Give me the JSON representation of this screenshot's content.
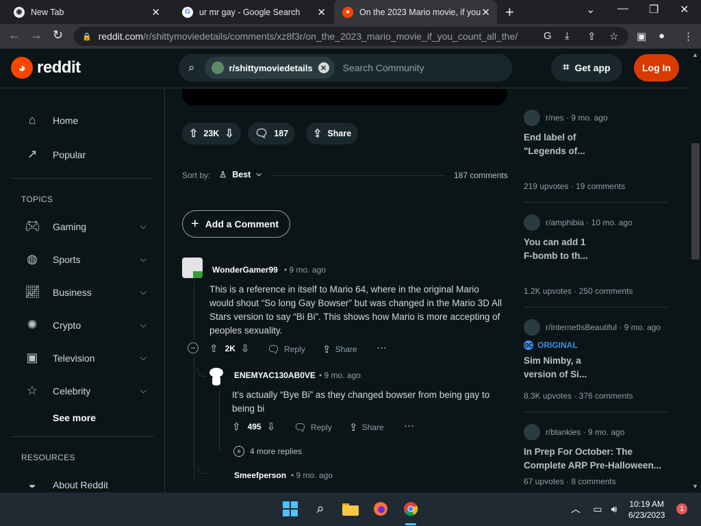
{
  "browser": {
    "tabs": [
      {
        "title": "New Tab"
      },
      {
        "title": "ur mr gay - Google Search"
      },
      {
        "title": "On the 2023 Mario movie, if you"
      }
    ],
    "url_host": "reddit.com",
    "url_path": "/r/shittymoviedetails/comments/xz8f3r/on_the_2023_mario_movie_if_you_count_all_the/"
  },
  "header": {
    "logo_text": "reddit",
    "community_chip": "r/shittymoviedetails",
    "search_placeholder": "Search Community",
    "get_app": "Get app",
    "login": "Log In"
  },
  "sidebar": {
    "top_items": [
      {
        "label": "Home",
        "icon": "home-icon"
      },
      {
        "label": "Popular",
        "icon": "popular-icon"
      }
    ],
    "topics_heading": "TOPICS",
    "topics": [
      {
        "label": "Gaming",
        "icon": "gamepad-icon"
      },
      {
        "label": "Sports",
        "icon": "ball-icon"
      },
      {
        "label": "Business",
        "icon": "chart-icon"
      },
      {
        "label": "Crypto",
        "icon": "crypto-icon"
      },
      {
        "label": "Television",
        "icon": "tv-icon"
      },
      {
        "label": "Celebrity",
        "icon": "star-icon"
      }
    ],
    "see_more": "See more",
    "resources_heading": "RESOURCES",
    "resources": [
      {
        "label": "About Reddit",
        "icon": "reddit-icon"
      }
    ]
  },
  "post_actions": {
    "votes": "23K",
    "comments": "187",
    "share": "Share"
  },
  "sort": {
    "label": "Sort by:",
    "value": "Best",
    "count": "187 comments"
  },
  "add_comment": "Add a Comment",
  "comments": [
    {
      "author": "WonderGamer99",
      "age": "9 mo. ago",
      "text": "This is a reference in itself to Mario 64, where in the original Mario would shout “So long Gay Bowser” but was changed in the Mario 3D All Stars version to say “Bi Bi”. This shows how Mario is more accepting of peoples sexuality.",
      "votes": "2K",
      "reply": "Reply",
      "share": "Share"
    },
    {
      "author": "ENEMYAC130AB0VE",
      "age": "9 mo. ago",
      "text": "It's actually “Bye Bi” as they changed bowser from being gay to being bi",
      "votes": "495",
      "reply": "Reply",
      "share": "Share",
      "more_replies": "4 more replies"
    },
    {
      "author": "Smeefperson",
      "age": "9 mo. ago"
    }
  ],
  "right_sidebar": [
    {
      "sub": "r/nes",
      "age": "9 mo. ago",
      "title": "End label of \"Legends of...",
      "upvotes": "219 upvotes",
      "comments": "19 comments"
    },
    {
      "sub": "r/amphibia",
      "age": "10 mo. ago",
      "title": "You can add 1 F-bomb to th...",
      "upvotes": "1.2K upvotes",
      "comments": "250 comments"
    },
    {
      "sub": "r/InternetIsBeautiful",
      "age": "9 mo. ago",
      "badge": "ORIGINAL",
      "title": "Sim Nimby, a version of Si...",
      "upvotes": "8.3K upvotes",
      "comments": "376 comments"
    },
    {
      "sub": "r/blankies",
      "age": "9 mo. ago",
      "title": "In Prep For October: The Complete ARP Pre-Halloween...",
      "upvotes": "67 upvotes",
      "comments": "8 comments"
    }
  ],
  "taskbar": {
    "time": "10:19 AM",
    "date": "6/23/2023",
    "notifications": "1"
  }
}
